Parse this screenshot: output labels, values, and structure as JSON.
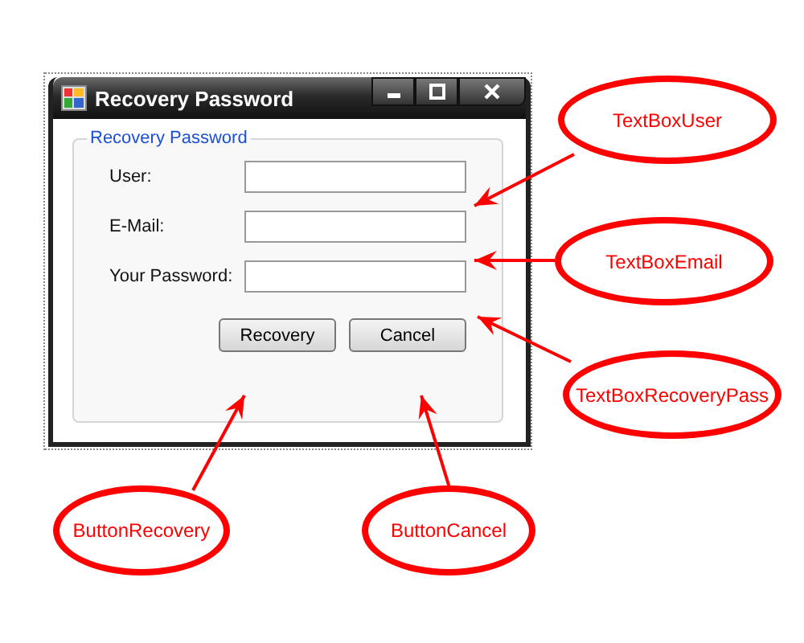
{
  "window": {
    "title": "Recovery Password"
  },
  "group": {
    "caption": "Recovery Password",
    "fields": [
      {
        "label": "User:"
      },
      {
        "label": "E-Mail:"
      },
      {
        "label": "Your Password:"
      }
    ],
    "buttons": [
      "Recovery",
      "Cancel"
    ]
  },
  "callouts": [
    "TextBoxUser",
    "TextBoxEmail",
    "TextBoxRecoveryPass",
    "ButtonRecovery",
    "ButtonCancel"
  ]
}
